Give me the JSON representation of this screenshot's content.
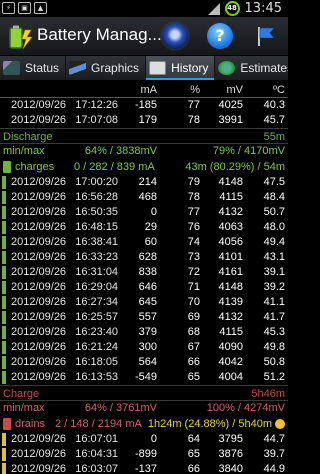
{
  "status_bar": {
    "left_icons": [
      "usb-icon",
      "sim-icon",
      "image-icon"
    ],
    "time": "13:45",
    "battery_level": "48",
    "battery_color": "#7ad11f"
  },
  "action_bar": {
    "title": "Battery Manag..."
  },
  "tabs": [
    {
      "label": "Status",
      "active": false
    },
    {
      "label": "Graphics",
      "active": false
    },
    {
      "label": "History",
      "active": true
    },
    {
      "label": "Estimates",
      "active": false
    }
  ],
  "table": {
    "headers": {
      "ma": "mA",
      "pct": "%",
      "mv": "mV",
      "temp": "ºC"
    },
    "top_rows": [
      {
        "date": "2012/09/26",
        "time": "17:12:26",
        "ma": "-185",
        "pct": "77",
        "mv": "4025",
        "temp": "40.3"
      },
      {
        "date": "2012/09/26",
        "time": "17:07:08",
        "ma": "179",
        "pct": "78",
        "mv": "3991",
        "temp": "45.7"
      }
    ],
    "discharge": {
      "label": "Discharge",
      "duration": "55m",
      "minmax_label": "min/max",
      "minmax_mid": "64% / 3838mV",
      "minmax_right": "79% / 4170mV"
    },
    "charges": {
      "label": "charges",
      "counts": "0 / 282 / 839 mA",
      "right": "43m (80.29%) / 54m"
    },
    "charge_rows": [
      {
        "date": "2012/09/26",
        "time": "17:00:20",
        "ma": "214",
        "pct": "79",
        "mv": "4148",
        "temp": "47.5"
      },
      {
        "date": "2012/09/26",
        "time": "16:56:28",
        "ma": "468",
        "pct": "78",
        "mv": "4115",
        "temp": "48.4"
      },
      {
        "date": "2012/09/26",
        "time": "16:50:35",
        "ma": "0",
        "pct": "77",
        "mv": "4132",
        "temp": "50.7"
      },
      {
        "date": "2012/09/26",
        "time": "16:48:15",
        "ma": "29",
        "pct": "76",
        "mv": "4063",
        "temp": "48.0"
      },
      {
        "date": "2012/09/26",
        "time": "16:38:41",
        "ma": "60",
        "pct": "74",
        "mv": "4056",
        "temp": "49.4"
      },
      {
        "date": "2012/09/26",
        "time": "16:33:23",
        "ma": "628",
        "pct": "73",
        "mv": "4101",
        "temp": "43.1"
      },
      {
        "date": "2012/09/26",
        "time": "16:31:04",
        "ma": "838",
        "pct": "72",
        "mv": "4161",
        "temp": "39.1"
      },
      {
        "date": "2012/09/26",
        "time": "16:29:04",
        "ma": "646",
        "pct": "71",
        "mv": "4148",
        "temp": "39.2"
      },
      {
        "date": "2012/09/26",
        "time": "16:27:34",
        "ma": "645",
        "pct": "70",
        "mv": "4139",
        "temp": "41.1"
      },
      {
        "date": "2012/09/26",
        "time": "16:25:57",
        "ma": "557",
        "pct": "69",
        "mv": "4132",
        "temp": "41.7"
      },
      {
        "date": "2012/09/26",
        "time": "16:23:40",
        "ma": "379",
        "pct": "68",
        "mv": "4115",
        "temp": "45.3"
      },
      {
        "date": "2012/09/26",
        "time": "16:21:24",
        "ma": "300",
        "pct": "67",
        "mv": "4090",
        "temp": "49.8"
      },
      {
        "date": "2012/09/26",
        "time": "16:18:05",
        "ma": "564",
        "pct": "66",
        "mv": "4042",
        "temp": "50.8"
      },
      {
        "date": "2012/09/26",
        "time": "16:13:53",
        "ma": "-549",
        "pct": "65",
        "mv": "4004",
        "temp": "51.2"
      }
    ],
    "charge": {
      "label": "Charge",
      "duration": "5h46m",
      "minmax_label": "min/max",
      "minmax_mid": "64% / 3761mV",
      "minmax_right": "100% / 4274mV"
    },
    "drains": {
      "label": "drains",
      "counts": "2 / 148 / 2194 mA",
      "right": "1h24m (24.88%) / 5h40m"
    },
    "drain_rows": [
      {
        "date": "2012/09/26",
        "time": "16:07:01",
        "ma": "0",
        "pct": "64",
        "mv": "3795",
        "temp": "44.7"
      },
      {
        "date": "2012/09/26",
        "time": "16:04:31",
        "ma": "-899",
        "pct": "65",
        "mv": "3876",
        "temp": "39.7"
      },
      {
        "date": "2012/09/26",
        "time": "16:03:07",
        "ma": "-137",
        "pct": "66",
        "mv": "3840",
        "temp": "44.9"
      }
    ]
  },
  "colors": {
    "green": "#6fb33c",
    "red": "#c54a4a",
    "accent": "#2f9cd8"
  }
}
